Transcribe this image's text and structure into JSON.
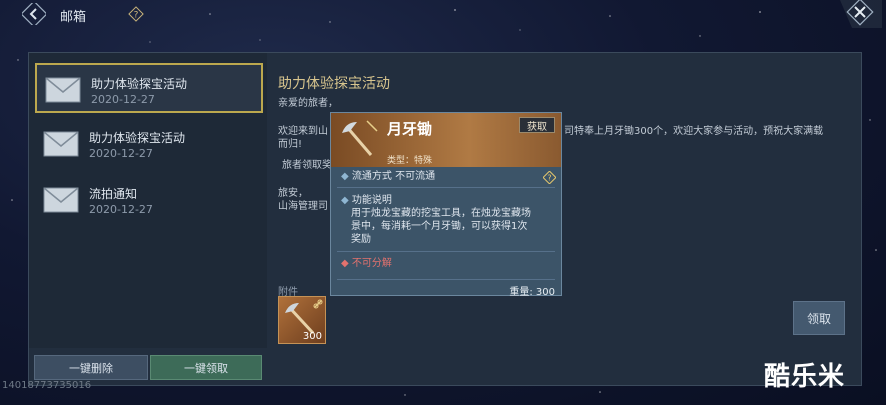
{
  "header": {
    "title": "邮箱"
  },
  "mails": [
    {
      "title": "助力体验探宝活动",
      "date": "2020-12-27"
    },
    {
      "title": "助力体验探宝活动",
      "date": "2020-12-27"
    },
    {
      "title": "流拍通知",
      "date": "2020-12-27"
    }
  ],
  "content": {
    "title": "助力体验探宝活动",
    "greeting": "亲爱的旅者，",
    "body_line1": "欢迎来到山",
    "body_line1_end": "司特奉上月牙锄300个，欢迎大家参与活动，预祝大家满载",
    "body_line2": "而归!",
    "body_line3": "旅者领取奖",
    "sign1": "旅安，",
    "sign2": "山海管理司"
  },
  "attachment": {
    "label": "附件",
    "count": "300"
  },
  "claim_button": "领取",
  "bottom": {
    "delete_all": "一键删除",
    "claim_all": "一键领取",
    "uid": "14018773735016"
  },
  "watermark": "酷乐米",
  "popup": {
    "name": "月牙锄",
    "type": "类型：特殊",
    "get_button": "获取",
    "circulation": "流通方式   不可流通",
    "func_title": "功能说明",
    "func_line1": "用于烛龙宝藏的挖宝工具，在烛龙宝藏场",
    "func_line2": "景中，每消耗一个月牙锄，可以获得1次",
    "func_line3": "奖励",
    "no_split": "不可分解",
    "weight": "重量: 300"
  },
  "icons": [
    "back-arrow-icon",
    "help-icon",
    "close-icon",
    "envelope-icon",
    "hoe-icon",
    "link-icon"
  ]
}
